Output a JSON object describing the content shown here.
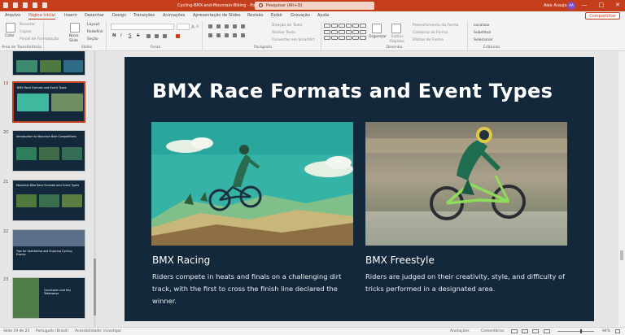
{
  "window": {
    "title": "Cycling-BMX-and-Mountain-Biking - PowerPoint",
    "search_placeholder": "Pesquisar (Alt+Q)",
    "user_name": "Alex Araujo",
    "user_initials": "AA",
    "minimize": "—",
    "maximize": "□",
    "close": "✕"
  },
  "ribbon_tabs": [
    "Arquivo",
    "Página Inicial",
    "Inserir",
    "Desenhar",
    "Design",
    "Transições",
    "Animações",
    "Apresentação de Slides",
    "Revisão",
    "Exibir",
    "Gravação",
    "Ajuda"
  ],
  "share_label": "Compartilhar",
  "ribbon": {
    "clipboard": {
      "paste": "Colar",
      "cut": "Recortar",
      "copy": "Copiar",
      "format_painter": "Pincel de Formatação",
      "label": "Área de Transferência"
    },
    "slides": {
      "new_slide_line1": "Novo",
      "new_slide_line2": "Slide",
      "layout": "Layout",
      "reset": "Redefinir",
      "section": "Seção",
      "label": "Slides"
    },
    "font": {
      "label": "Fonte",
      "bold": "N",
      "italic": "I",
      "underline": "S",
      "strike": "S",
      "grow": "A",
      "shrink": "A"
    },
    "paragraph": {
      "text_direction": "Direção do Texto",
      "align_text": "Alinhar Texto",
      "smartart": "Converter em SmartArt",
      "label": "Parágrafo"
    },
    "drawing": {
      "arrange": "Organizar",
      "quick_styles_1": "Estilos",
      "quick_styles_2": "Rápidos",
      "shape_fill": "Preenchimento da Forma",
      "shape_outline": "Contorno da Forma",
      "shape_effects": "Efeitos de Forma",
      "label": "Desenho"
    },
    "editing": {
      "find": "Localizar",
      "replace": "Substituir",
      "select": "Selecionar",
      "label": "Editando"
    }
  },
  "thumbnails": [
    {
      "num": "",
      "title": ""
    },
    {
      "num": "19",
      "title": "BMX Race Formats and Event Types"
    },
    {
      "num": "20",
      "title": "Introduction to Mountain Bike Competitions"
    },
    {
      "num": "21",
      "title": "Mountain Bike Race Formats and Event Types"
    },
    {
      "num": "22",
      "title": "Tips for Spectating and Enjoying Cycling Events"
    },
    {
      "num": "23",
      "title": "Conclusion and Key Takeaways"
    }
  ],
  "slide": {
    "title": "BMX Race Formats and Event Types",
    "col1_title": "BMX Racing",
    "col1_body": "Riders compete in heats and finals on a challenging dirt track, with the first to cross the finish line declared the winner.",
    "col2_title": "BMX Freestyle",
    "col2_body": "Riders are judged on their creativity, style, and difficulty of tricks performed in a designated area."
  },
  "status": {
    "slide_of": "Slide 19 de 23",
    "language": "Português (Brasil)",
    "accessibility": "Acessibilidade: investigar",
    "notes": "Anotações",
    "comments": "Comentários",
    "zoom": "94%"
  },
  "colors": {
    "accent": "#c43e1c",
    "slide_bg": "#13283a"
  }
}
